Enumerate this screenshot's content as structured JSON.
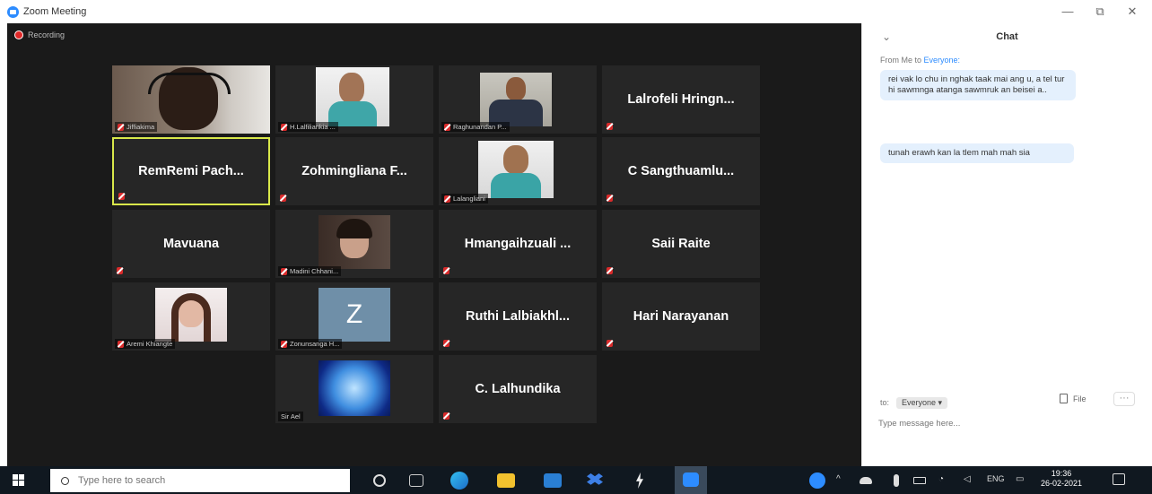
{
  "window": {
    "title": "Zoom Meeting",
    "minimize": "—",
    "maximize": "⧉",
    "close": "✕"
  },
  "recording": {
    "label": "Recording"
  },
  "tiles": {
    "t1": {
      "label": "Jiffiakima"
    },
    "t2": {
      "label": "H.Lalfiliankia ..."
    },
    "t3": {
      "label": "Raghunandan P..."
    },
    "t4": {
      "name": "Lalrofeli  Hringn..."
    },
    "t5": {
      "name": "RemRemi  Pach..."
    },
    "t6": {
      "name": "Zohmingliana  F..."
    },
    "t7": {
      "label": "Lalangliani"
    },
    "t8": {
      "name": "C  Sangthuamlu..."
    },
    "t9": {
      "name": "Mavuana"
    },
    "t10": {
      "label": "Madini Chhani..."
    },
    "t11": {
      "name": "Hmangaihzuali ..."
    },
    "t12": {
      "name": "Saii Raite"
    },
    "t13": {
      "label": "Aremi Khiangte"
    },
    "t14": {
      "label": "Zonunsanga H...",
      "avatar_letter": "Z"
    },
    "t15": {
      "name": "Ruthi  Lalbiakhl..."
    },
    "t16": {
      "name": "Hari  Narayanan"
    },
    "t17": {
      "label": "Sir Ael"
    },
    "t18": {
      "name": "C.  Lalhundika"
    }
  },
  "chat": {
    "collapse": "⌄",
    "title": "Chat",
    "from_prefix": "From Me to ",
    "from_target": "Everyone:",
    "messages": [
      {
        "text": "rei vak lo chu in nghak taak mai ang u, a tel tur hi sawmnga atanga sawmruk an beisei a.."
      },
      {
        "text": "tunah erawh kan la tlem mah mah sia"
      }
    ],
    "to_label": "to:",
    "recipient": "Everyone ▾",
    "file_label": "File",
    "more": "···",
    "input_placeholder": "Type message here..."
  },
  "taskbar": {
    "search_placeholder": "Type here to search",
    "lang": "ENG",
    "time": "19:36",
    "date": "26-02-2021"
  },
  "colors": {
    "meeting_bg": "#1a1a1a",
    "tile_bg": "#262626",
    "active_speaker": "#d9e84a",
    "chat_bubble": "#e4f0fd",
    "link_blue": "#2d8cff",
    "mute_red": "#d92b2b"
  }
}
